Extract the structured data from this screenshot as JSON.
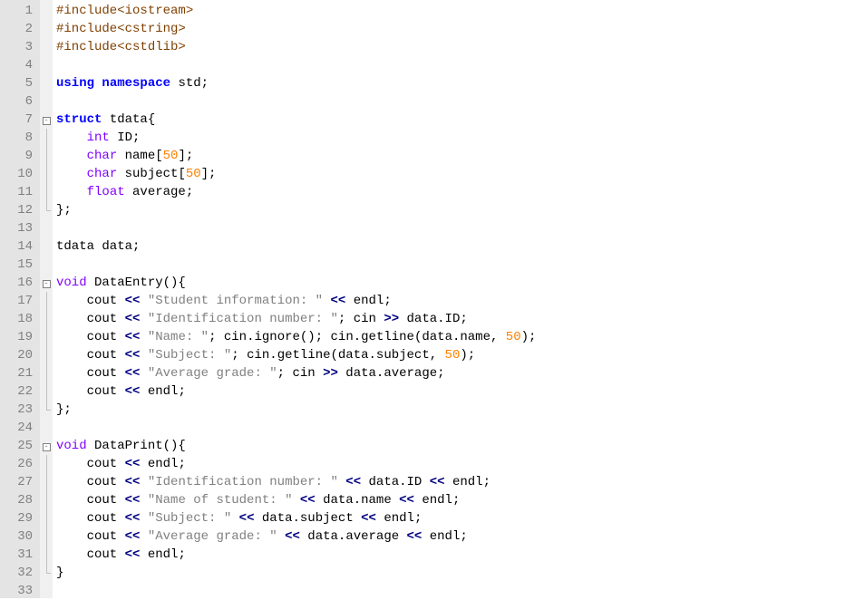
{
  "lines": [
    {
      "n": 1,
      "fold": "",
      "html": "<span class='pp'>#include&lt;iostream&gt;</span>"
    },
    {
      "n": 2,
      "fold": "",
      "html": "<span class='pp'>#include&lt;cstring&gt;</span>"
    },
    {
      "n": 3,
      "fold": "",
      "html": "<span class='pp'>#include&lt;cstdlib&gt;</span>"
    },
    {
      "n": 4,
      "fold": "",
      "html": ""
    },
    {
      "n": 5,
      "fold": "",
      "html": "<span class='kw'>using</span> <span class='kw'>namespace</span> std<span class='pn'>;</span>"
    },
    {
      "n": 6,
      "fold": "",
      "html": ""
    },
    {
      "n": 7,
      "fold": "open",
      "html": "<span class='kw'>struct</span> tdata<span class='pn'>{</span>"
    },
    {
      "n": 8,
      "fold": "line",
      "html": "    <span class='ty'>int</span> ID<span class='pn'>;</span>"
    },
    {
      "n": 9,
      "fold": "line",
      "html": "    <span class='ty'>char</span> name<span class='pn'>[</span><span class='num'>50</span><span class='pn'>];</span>"
    },
    {
      "n": 10,
      "fold": "line",
      "html": "    <span class='ty'>char</span> subject<span class='pn'>[</span><span class='num'>50</span><span class='pn'>];</span>"
    },
    {
      "n": 11,
      "fold": "line",
      "html": "    <span class='ty'>float</span> average<span class='pn'>;</span>"
    },
    {
      "n": 12,
      "fold": "end",
      "html": "<span class='pn'>};</span>"
    },
    {
      "n": 13,
      "fold": "",
      "html": ""
    },
    {
      "n": 14,
      "fold": "",
      "html": "tdata data<span class='pn'>;</span>"
    },
    {
      "n": 15,
      "fold": "",
      "html": ""
    },
    {
      "n": 16,
      "fold": "open",
      "html": "<span class='ty'>void</span> DataEntry<span class='pn'>(){</span>"
    },
    {
      "n": 17,
      "fold": "line",
      "html": "    cout <span class='op'>&lt;&lt;</span> <span class='str'>\"Student information: \"</span> <span class='op'>&lt;&lt;</span> endl<span class='pn'>;</span>"
    },
    {
      "n": 18,
      "fold": "line",
      "html": "    cout <span class='op'>&lt;&lt;</span> <span class='str'>\"Identification number: \"</span><span class='pn'>;</span> cin <span class='op'>&gt;&gt;</span> data<span class='pn'>.</span>ID<span class='pn'>;</span>"
    },
    {
      "n": 19,
      "fold": "line",
      "html": "    cout <span class='op'>&lt;&lt;</span> <span class='str'>\"Name: \"</span><span class='pn'>;</span> cin<span class='pn'>.</span>ignore<span class='pn'>();</span> cin<span class='pn'>.</span>getline<span class='pn'>(</span>data<span class='pn'>.</span>name<span class='pn'>,</span> <span class='num'>50</span><span class='pn'>);</span>"
    },
    {
      "n": 20,
      "fold": "line",
      "html": "    cout <span class='op'>&lt;&lt;</span> <span class='str'>\"Subject: \"</span><span class='pn'>;</span> cin<span class='pn'>.</span>getline<span class='pn'>(</span>data<span class='pn'>.</span>subject<span class='pn'>,</span> <span class='num'>50</span><span class='pn'>);</span>"
    },
    {
      "n": 21,
      "fold": "line",
      "html": "    cout <span class='op'>&lt;&lt;</span> <span class='str'>\"Average grade: \"</span><span class='pn'>;</span> cin <span class='op'>&gt;&gt;</span> data<span class='pn'>.</span>average<span class='pn'>;</span>"
    },
    {
      "n": 22,
      "fold": "line",
      "html": "    cout <span class='op'>&lt;&lt;</span> endl<span class='pn'>;</span>"
    },
    {
      "n": 23,
      "fold": "end",
      "html": "<span class='pn'>};</span>"
    },
    {
      "n": 24,
      "fold": "",
      "html": ""
    },
    {
      "n": 25,
      "fold": "open",
      "html": "<span class='ty'>void</span> DataPrint<span class='pn'>(){</span>"
    },
    {
      "n": 26,
      "fold": "line",
      "html": "    cout <span class='op'>&lt;&lt;</span> endl<span class='pn'>;</span>"
    },
    {
      "n": 27,
      "fold": "line",
      "html": "    cout <span class='op'>&lt;&lt;</span> <span class='str'>\"Identification number: \"</span> <span class='op'>&lt;&lt;</span> data<span class='pn'>.</span>ID <span class='op'>&lt;&lt;</span> endl<span class='pn'>;</span>"
    },
    {
      "n": 28,
      "fold": "line",
      "html": "    cout <span class='op'>&lt;&lt;</span> <span class='str'>\"Name of student: \"</span> <span class='op'>&lt;&lt;</span> data<span class='pn'>.</span>name <span class='op'>&lt;&lt;</span> endl<span class='pn'>;</span>"
    },
    {
      "n": 29,
      "fold": "line",
      "html": "    cout <span class='op'>&lt;&lt;</span> <span class='str'>\"Subject: \"</span> <span class='op'>&lt;&lt;</span> data<span class='pn'>.</span>subject <span class='op'>&lt;&lt;</span> endl<span class='pn'>;</span>"
    },
    {
      "n": 30,
      "fold": "line",
      "html": "    cout <span class='op'>&lt;&lt;</span> <span class='str'>\"Average grade: \"</span> <span class='op'>&lt;&lt;</span> data<span class='pn'>.</span>average <span class='op'>&lt;&lt;</span> endl<span class='pn'>;</span>"
    },
    {
      "n": 31,
      "fold": "line",
      "html": "    cout <span class='op'>&lt;&lt;</span> endl<span class='pn'>;</span>"
    },
    {
      "n": 32,
      "fold": "end",
      "html": "<span class='pn'>}</span>"
    },
    {
      "n": 33,
      "fold": "",
      "html": ""
    }
  ]
}
